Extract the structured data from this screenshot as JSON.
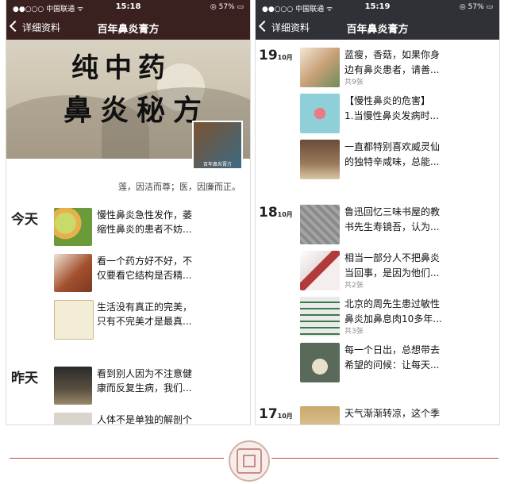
{
  "left": {
    "status": {
      "carrier": "●●○○○ 中国联通 ᯤ",
      "time": "15:18",
      "battery": "◎ 57% ▭"
    },
    "nav": {
      "back": "详细资料",
      "title": "百年鼻炎膏方"
    },
    "cover": {
      "line1": "纯中药",
      "line2": "鼻炎秘方",
      "avatar_caption": "百年鼻炎膏方"
    },
    "motto": "莲，因洁而尊；医，因廉而正。",
    "groups": [
      {
        "day": "今天",
        "items": [
          {
            "lines": [
              "慢性鼻炎急性发作，萎",
              "缩性鼻炎的患者不妨..."
            ]
          },
          {
            "lines": [
              "看一个药方好不好，不",
              "仅要看它结构是否精..."
            ]
          },
          {
            "lines": [
              "生活没有真正的完美，",
              "只有不完美才是最真..."
            ]
          }
        ]
      },
      {
        "day": "昨天",
        "items": [
          {
            "lines": [
              "看到别人因为不注意健",
              "康而反复生病，我们..."
            ]
          },
          {
            "lines": [
              "人体不是单独的解剖个",
              ""
            ]
          }
        ]
      }
    ]
  },
  "right": {
    "status": {
      "carrier": "●●○○○ 中国联通 ᯤ",
      "time": "15:19",
      "battery": "◎ 57% ▭"
    },
    "nav": {
      "back": "详细资料",
      "title": "百年鼻炎膏方"
    },
    "groups": [
      {
        "day": "19",
        "month": "10月",
        "items": [
          {
            "lines": [
              "蓝瘦，香菇，如果你身",
              "边有鼻炎患者，请善..."
            ],
            "count": "共9张"
          },
          {
            "lines": [
              "【慢性鼻炎的危害】",
              "1.当慢性鼻炎发病时..."
            ],
            "count": ""
          },
          {
            "lines": [
              "一直都特别喜欢威灵仙",
              "的独特辛咸味，总能..."
            ],
            "count": ""
          }
        ]
      },
      {
        "day": "18",
        "month": "10月",
        "items": [
          {
            "lines": [
              "鲁迅回忆三味书屋的教",
              "书先生寿镜吾，认为..."
            ],
            "count": ""
          },
          {
            "lines": [
              "相当一部分人不把鼻炎",
              "当回事，是因为他们..."
            ],
            "count": "共2张"
          },
          {
            "lines": [
              "北京的周先生患过敏性",
              "鼻炎加鼻息肉10多年..."
            ],
            "count": "共3张"
          },
          {
            "lines": [
              "每一个日出，总想带去",
              "希望的问候：让每天..."
            ],
            "count": ""
          }
        ]
      },
      {
        "day": "17",
        "month": "10月",
        "items": [
          {
            "lines": [
              "天气渐渐转凉，这个季",
              ""
            ],
            "count": ""
          }
        ]
      }
    ]
  },
  "colors": {
    "left_bar": "#3b2020",
    "right_bar": "#2f3136",
    "divider": "#b84a3a"
  }
}
